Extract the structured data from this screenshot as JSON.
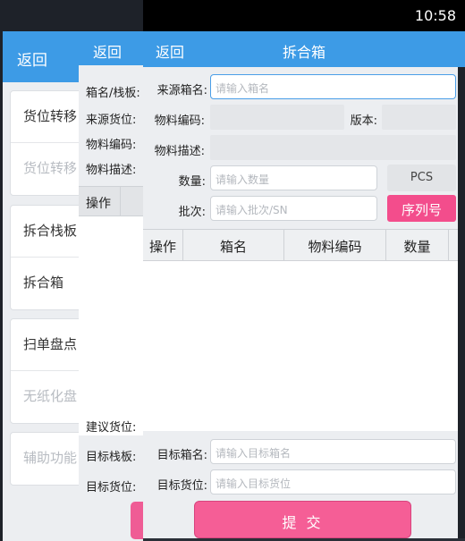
{
  "status_bar": {
    "time": "10:58"
  },
  "back_layer": {
    "back_label": "返回",
    "groups": [
      {
        "items": [
          {
            "label": "货位转移",
            "enabled": true
          },
          {
            "label": "货位转移",
            "enabled": false
          }
        ]
      },
      {
        "items": [
          {
            "label": "拆合栈板",
            "enabled": true
          },
          {
            "label": "拆合箱",
            "enabled": true
          }
        ]
      },
      {
        "items": [
          {
            "label": "扫单盘点",
            "enabled": true
          },
          {
            "label": "无纸化盘",
            "enabled": false
          }
        ]
      },
      {
        "items": [
          {
            "label": "辅助功能",
            "enabled": false
          }
        ]
      }
    ]
  },
  "middle_layer": {
    "back_label": "返回",
    "labels": {
      "box_pallet": "箱名/栈板:",
      "source_location": "来源货位:",
      "material_code": "物料编码:",
      "material_desc": "物料描述:"
    },
    "table_header": "操作",
    "suggested_location": "建议货位:",
    "target_pallet": "目标栈板:",
    "target_location": "目标货位:"
  },
  "main": {
    "back_label": "返回",
    "title": "拆合箱",
    "form": {
      "source_box_label": "来源箱名:",
      "source_box_placeholder": "请输入箱名",
      "material_code_label": "物料编码:",
      "version_label": "版本:",
      "material_desc_label": "物料描述:",
      "quantity_label": "数量:",
      "quantity_placeholder": "请输入数量",
      "unit": "PCS",
      "batch_label": "批次:",
      "batch_placeholder": "请输入批次/SN",
      "serial_button": "序列号",
      "target_box_label": "目标箱名:",
      "target_box_placeholder": "请输入目标箱名",
      "target_location_label": "目标货位:",
      "target_location_placeholder": "请输入目标货位"
    },
    "table": {
      "columns": [
        "操作",
        "箱名",
        "物料编码",
        "数量"
      ]
    },
    "submit_label": "提 交"
  },
  "colors": {
    "header_blue": "#3d9be6",
    "accent_pink": "#f34d8c",
    "submit_pink": "#f55e96"
  }
}
